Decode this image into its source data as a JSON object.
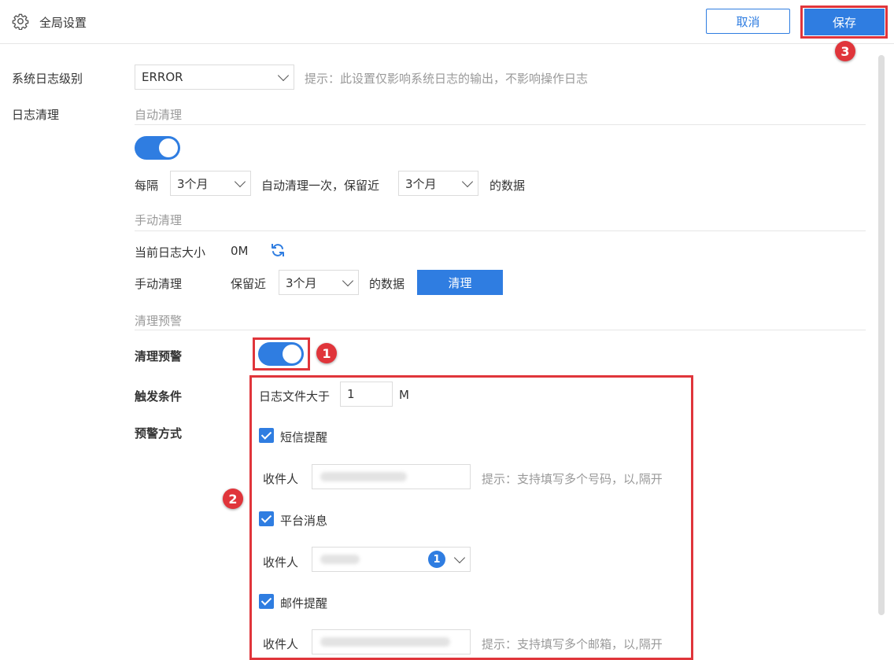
{
  "header": {
    "title": "全局设置",
    "cancel_label": "取消",
    "save_label": "保存",
    "gear_icon": "gear-icon"
  },
  "annotations": {
    "marker_1": "1",
    "marker_2": "2",
    "marker_3": "3",
    "highlight_color": "#e0353b"
  },
  "log_level": {
    "label": "系统日志级别",
    "value": "ERROR",
    "hint": "提示：此设置仅影响系统日志的输出，不影响操作日志"
  },
  "log_clean": {
    "label": "日志清理",
    "auto": {
      "section_title": "自动清理",
      "enabled": true,
      "every_label": "每隔",
      "interval_value": "3个月",
      "middle_text": "自动清理一次，保留近",
      "retain_value": "3个月",
      "suffix_text": "的数据"
    },
    "manual": {
      "section_title": "手动清理",
      "size_label": "当前日志大小",
      "size_value": "0M",
      "clean_label": "手动清理",
      "retain_label": "保留近",
      "retain_value": "3个月",
      "suffix_text": "的数据",
      "clean_button": "清理"
    },
    "warning": {
      "section_title": "清理预警",
      "toggle_label": "清理预警",
      "enabled": true,
      "trigger_label": "触发条件",
      "method_label": "预警方式",
      "file_size_label": "日志文件大于",
      "file_size_value": "1",
      "file_size_unit": "M",
      "sms": {
        "label": "短信提醒",
        "checked": true,
        "recipient_label": "收件人",
        "hint": "提示：支持填写多个号码，以,隔开"
      },
      "platform": {
        "label": "平台消息",
        "checked": true,
        "recipient_label": "收件人",
        "count": "1"
      },
      "email": {
        "label": "邮件提醒",
        "checked": true,
        "recipient_label": "收件人",
        "hint": "提示：支持填写多个邮箱，以,隔开"
      }
    }
  },
  "colors": {
    "primary": "#2f7de1",
    "annotation_red": "#e0353b"
  }
}
